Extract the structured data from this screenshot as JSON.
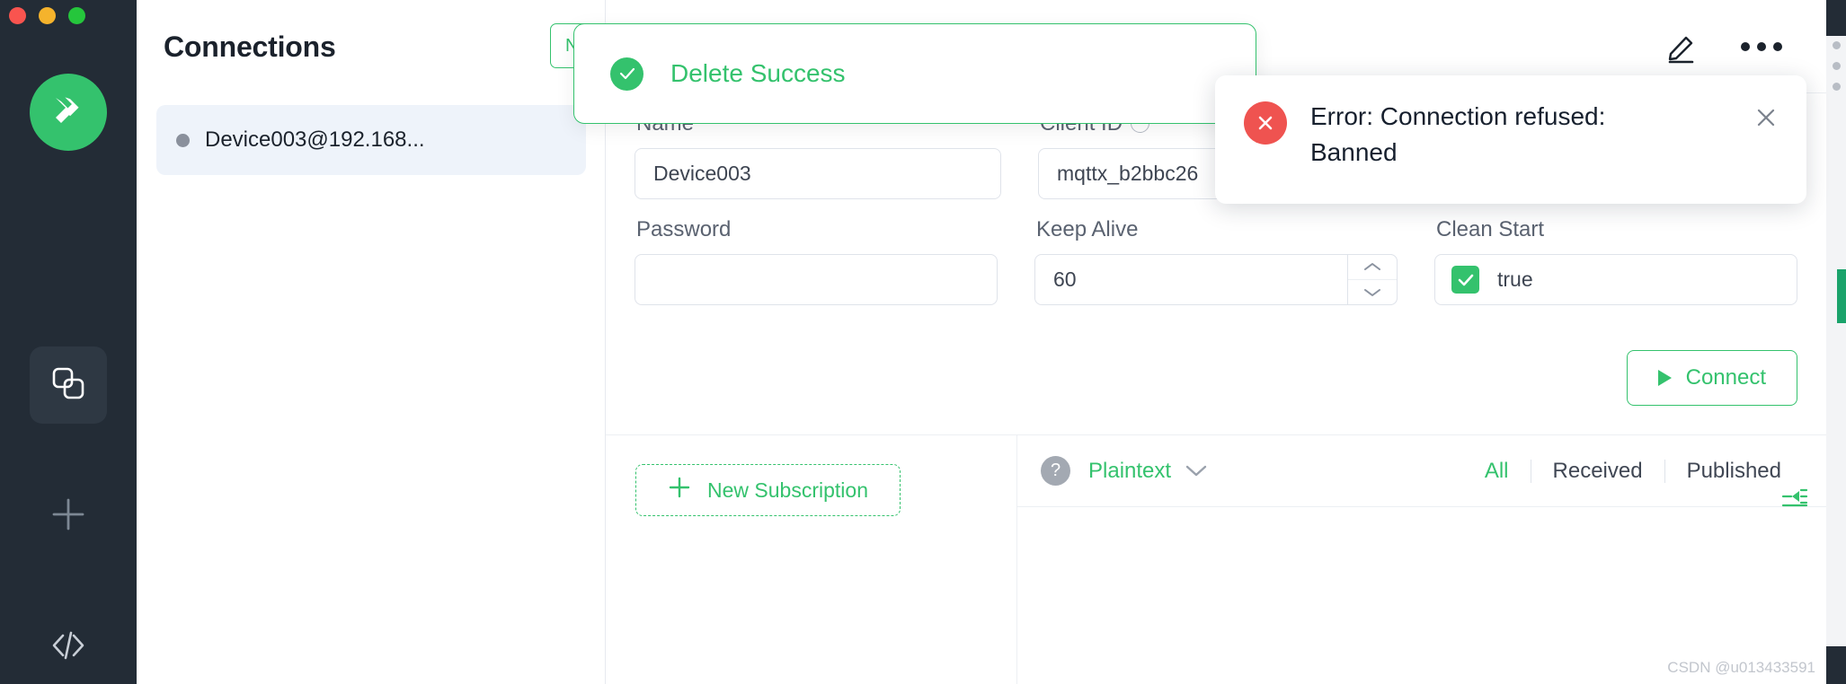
{
  "window": {
    "traffic_lights": [
      "close-red",
      "minimize-yellow",
      "maximize-green"
    ]
  },
  "rail": {
    "logo_name": "mqttx-logo",
    "items": [
      {
        "name": "connections-icon",
        "glyph": "two-squares",
        "active": true
      },
      {
        "name": "new-connection-icon",
        "glyph": "plus",
        "active": false
      },
      {
        "name": "script-icon",
        "glyph": "code-brackets",
        "active": false
      }
    ]
  },
  "connections": {
    "title": "Connections",
    "new_collection_label": "New Collection",
    "items": [
      {
        "label": "Device003@192.168...",
        "status": "offline"
      }
    ]
  },
  "topbar": {
    "edit_icon": "pencil-icon",
    "more_icon": "more-horizontal-icon"
  },
  "form": {
    "fields": {
      "name": {
        "label": "Name",
        "value": "Device003",
        "placeholder": ""
      },
      "client_id": {
        "label": "Client ID",
        "value": "mqttx_b2bbc26",
        "placeholder": "",
        "has_info": true
      },
      "password": {
        "label": "Password",
        "value": "",
        "placeholder": ""
      },
      "keep_alive": {
        "label": "Keep Alive",
        "value": "60",
        "placeholder": ""
      },
      "clean_start": {
        "label": "Clean Start",
        "value": "true",
        "checked": true
      }
    },
    "connect_label": "Connect"
  },
  "subscriptions": {
    "new_subscription_label": "New Subscription",
    "collapse_icon": "collapse-list-icon"
  },
  "messages": {
    "help_icon": "question-mark-icon",
    "format_label": "Plaintext",
    "filters": [
      {
        "label": "All",
        "active": true
      },
      {
        "label": "Received",
        "active": false
      },
      {
        "label": "Published",
        "active": false
      }
    ]
  },
  "toasts": {
    "success": {
      "icon": "check-circle-icon",
      "message": "Delete Success",
      "color": "#34c26d"
    },
    "error": {
      "icon": "error-circle-icon",
      "message": "Error: Connection refused: Banned",
      "close_icon": "close-icon",
      "color": "#ef5350"
    }
  },
  "watermark": "CSDN @u013433591"
}
